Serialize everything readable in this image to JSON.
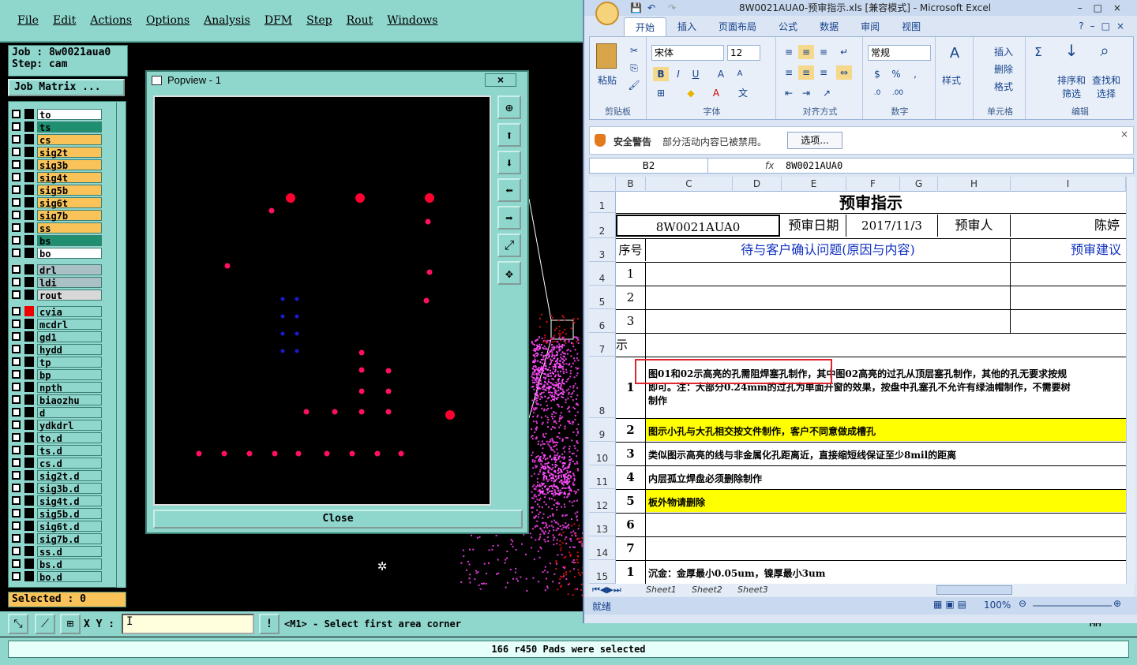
{
  "cam": {
    "menu": [
      "File",
      "Edit",
      "Actions",
      "Options",
      "Analysis",
      "DFM",
      "Step",
      "Rout",
      "Windows"
    ],
    "job_label": "Job : 8w0021aua0",
    "step_label": "Step: cam",
    "job_matrix_btn": "Job Matrix ...",
    "layers": [
      {
        "name": "to",
        "color": "#ffffff"
      },
      {
        "name": "ts",
        "color": "#1f8f6f"
      },
      {
        "name": "cs",
        "color": "#f9c35a"
      },
      {
        "name": "sig2t",
        "color": "#f9c35a"
      },
      {
        "name": "sig3b",
        "color": "#f9c35a"
      },
      {
        "name": "sig4t",
        "color": "#f9c35a"
      },
      {
        "name": "sig5b",
        "color": "#f9c35a"
      },
      {
        "name": "sig6t",
        "color": "#f9c35a"
      },
      {
        "name": "sig7b",
        "color": "#f9c35a"
      },
      {
        "name": "ss",
        "color": "#f9c35a"
      },
      {
        "name": "bs",
        "color": "#1f8f6f"
      },
      {
        "name": "bo",
        "color": "#ffffff"
      },
      {
        "name": "drl",
        "color": "#a9c0c4"
      },
      {
        "name": "ldi",
        "color": "#a9c0c4"
      },
      {
        "name": "rout",
        "color": "#d8d8d8"
      },
      {
        "name": "cvia",
        "color": "#8fd6cc"
      },
      {
        "name": "mcdrl",
        "color": "#8fd6cc"
      },
      {
        "name": "gd1",
        "color": "#8fd6cc"
      },
      {
        "name": "hydd",
        "color": "#8fd6cc"
      },
      {
        "name": "tp",
        "color": "#8fd6cc"
      },
      {
        "name": "bp",
        "color": "#8fd6cc"
      },
      {
        "name": "npth",
        "color": "#8fd6cc"
      },
      {
        "name": "biaozhu",
        "color": "#8fd6cc"
      },
      {
        "name": "d",
        "color": "#8fd6cc"
      },
      {
        "name": "ydkdrl",
        "color": "#8fd6cc"
      },
      {
        "name": "to.d",
        "color": "#8fd6cc"
      },
      {
        "name": "ts.d",
        "color": "#8fd6cc"
      },
      {
        "name": "cs.d",
        "color": "#8fd6cc"
      },
      {
        "name": "sig2t.d",
        "color": "#8fd6cc"
      },
      {
        "name": "sig3b.d",
        "color": "#8fd6cc"
      },
      {
        "name": "sig4t.d",
        "color": "#8fd6cc"
      },
      {
        "name": "sig5b.d",
        "color": "#8fd6cc"
      },
      {
        "name": "sig6t.d",
        "color": "#8fd6cc"
      },
      {
        "name": "sig7b.d",
        "color": "#8fd6cc"
      },
      {
        "name": "ss.d",
        "color": "#8fd6cc"
      },
      {
        "name": "bs.d",
        "color": "#8fd6cc"
      },
      {
        "name": "bo.d",
        "color": "#8fd6cc"
      }
    ],
    "selected": "Selected : 0",
    "xy_label": "X Y :",
    "xy_value": "",
    "prompt": "<M1> - Select first area corner",
    "status": "166 r450 Pads were selected",
    "mm_label": "MM"
  },
  "popview": {
    "title": "Popview - 1",
    "close_btn": "Close",
    "close_x": "×"
  },
  "excel": {
    "title": "8W0021AUA0-预审指示.xls  [兼容模式] - Microsoft Excel",
    "tabs": [
      "开始",
      "插入",
      "页面布局",
      "公式",
      "数据",
      "审阅",
      "视图"
    ],
    "ribbon": {
      "paste": "粘贴",
      "clipboard": "剪贴板",
      "font_name": "宋体",
      "font_size": "12",
      "font_group": "字体",
      "align_group": "对齐方式",
      "number_format": "常规",
      "number_group": "数字",
      "styles": "样式",
      "insert": "插入",
      "delete": "删除",
      "format": "格式",
      "cells_group": "单元格",
      "sort_filter": "排序和\n筛选",
      "find_select": "查找和\n选择",
      "edit_group": "编辑"
    },
    "security": {
      "title": "安全警告",
      "message": "部分活动内容已被禁用。",
      "button": "选项..."
    },
    "name_box": "B2",
    "formula": "8W0021AUA0",
    "columns": [
      "B",
      "C",
      "D",
      "E",
      "F",
      "G",
      "H",
      "I"
    ],
    "rows": [
      "1",
      "2",
      "3",
      "4",
      "5",
      "6",
      "7",
      "8",
      "9",
      "10",
      "11",
      "12",
      "13",
      "14",
      "15"
    ],
    "header_title": "预审指示",
    "job_cell": "8W0021AUA0",
    "date_label": "预审日期",
    "date_value": "2017/11/3",
    "reviewer_label": "预审人",
    "reviewer_value": "陈婷",
    "col_seq": "序号",
    "col_issue": "待与客户确认问题(原因与内容)",
    "col_advice": "预审建议",
    "row7_label": "示",
    "items": [
      {
        "n": "1",
        "text": ""
      },
      {
        "n": "2",
        "text": ""
      },
      {
        "n": "3",
        "text": ""
      }
    ],
    "instructions": [
      {
        "n": "1",
        "line1": "图01和02示高亮的孔需阻焊塞孔制作，其中图02高亮的过孔从顶层塞孔制作，其他的孔无要求按规",
        "line2": "即可。注：大部分0.24mm的过孔为单面开窗的效果，按盘中孔塞孔不允许有绿油帽制作，不需要树",
        "line3": "制作",
        "hl": false
      },
      {
        "n": "2",
        "line1": "图示小孔与大孔相交按文件制作，客户不同意做成槽孔",
        "hl": true
      },
      {
        "n": "3",
        "line1": "类似图示高亮的线与非金属化孔距离近，直接缩短线保证至少8mil的距离",
        "hl": false
      },
      {
        "n": "4",
        "line1": "内层孤立焊盘必须删除制作",
        "hl": false
      },
      {
        "n": "5",
        "line1": "板外物请删除",
        "hl": true
      },
      {
        "n": "6",
        "line1": "",
        "hl": false
      },
      {
        "n": "7",
        "line1": "",
        "hl": false
      },
      {
        "n": "1",
        "line1": "沉金：金厚最小0.05um，镍厚最小3um",
        "hl": false
      }
    ],
    "sheets": [
      "Sheet1",
      "Sheet2",
      "Sheet3"
    ],
    "status_ready": "就绪",
    "zoom": "100%"
  }
}
